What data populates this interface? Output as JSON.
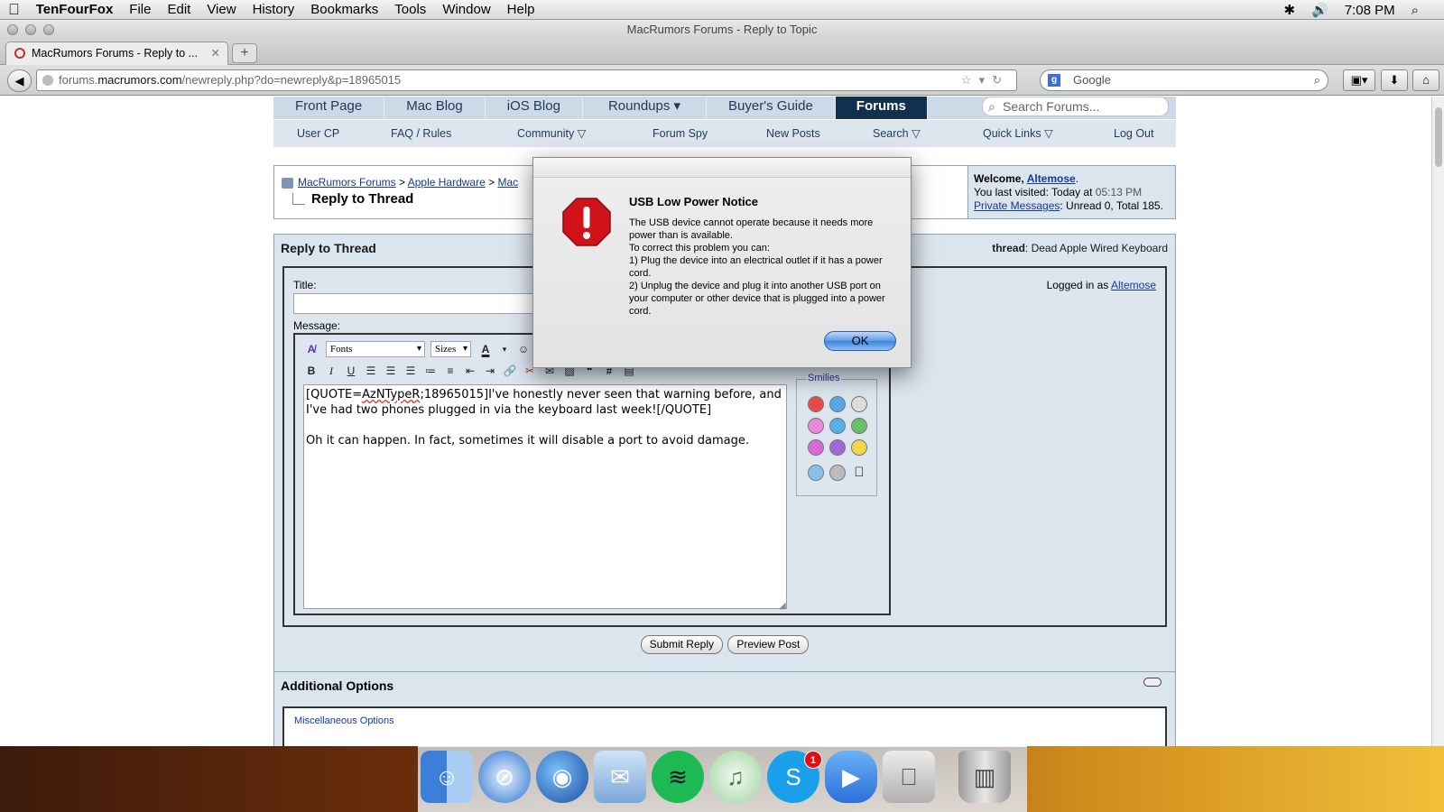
{
  "menubar": {
    "app_name": "TenFourFox",
    "items": [
      "File",
      "Edit",
      "View",
      "History",
      "Bookmarks",
      "Tools",
      "Window",
      "Help"
    ],
    "clock": "7:08 PM"
  },
  "window": {
    "title": "MacRumors Forums - Reply to Topic"
  },
  "tab": {
    "label": "MacRumors Forums - Reply to ..."
  },
  "urlbar": {
    "prefix": "forums.",
    "domain": "macrumors.com",
    "path": "/newreply.php?do=newreply&p=18965015"
  },
  "searchbar": {
    "placeholder": "Google"
  },
  "site_nav": {
    "tabs": [
      "Front Page",
      "Mac Blog",
      "iOS Blog",
      "Roundups ▾",
      "Buyer's Guide",
      "Forums"
    ],
    "search_placeholder": "Search Forums..."
  },
  "sub_nav": {
    "items": [
      "User CP",
      "FAQ / Rules",
      "Community ▽",
      "Forum Spy",
      "New Posts",
      "Search ▽",
      "Quick Links ▽",
      "Log Out"
    ]
  },
  "breadcrumb": {
    "items": [
      "MacRumors Forums",
      "Apple Hardware",
      "Mac"
    ],
    "sep": ">",
    "page_title": "Reply to Thread"
  },
  "welcome": {
    "greeting": "Welcome, ",
    "user": "Altemose",
    "last_visited_label": "You last visited: Today at ",
    "last_visited_time": "05:13 PM",
    "pm_link": "Private Messages",
    "pm_counts": ": Unread 0, Total 185."
  },
  "reply": {
    "heading": "Reply to Thread",
    "thread_label": "thread",
    "thread_title": ": Dead Apple Wired Keyboard",
    "title_label": "Title:",
    "message_label": "Message:",
    "logged_in_label": "Logged in as ",
    "logged_in_user": "Altemose",
    "font_select": "Fonts",
    "size_select": "Sizes",
    "smilies_legend": "Smilies",
    "message_before": "[QUOTE=",
    "message_user": "AzNTypeR",
    "message_after": ";18965015]I've honestly never seen that warning before, and I've had two phones plugged in via the keyboard last week![/QUOTE]\n\nOh it can happen. In fact, sometimes it will disable a port to avoid damage.",
    "submit_label": "Submit Reply",
    "preview_label": "Preview Post"
  },
  "additional": {
    "heading": "Additional Options",
    "misc_legend": "Miscellaneous Options"
  },
  "dialog": {
    "title": "USB Low Power Notice",
    "message": "The USB device cannot operate because it needs more power than is available.\nTo correct this problem you can:\n1) Plug the device into an electrical outlet if it has a power cord.\n2) Unplug the device and plug it into another USB port on your computer or other device that is plugged into a power cord.",
    "ok_label": "OK"
  },
  "dock": {
    "skype_badge": "1"
  },
  "colors": {
    "site_nav_bg": "#cdd9e7",
    "active_tab": "#10304e",
    "panel_bg": "#dbe5ee",
    "dialog_stop": "#d0121b"
  }
}
